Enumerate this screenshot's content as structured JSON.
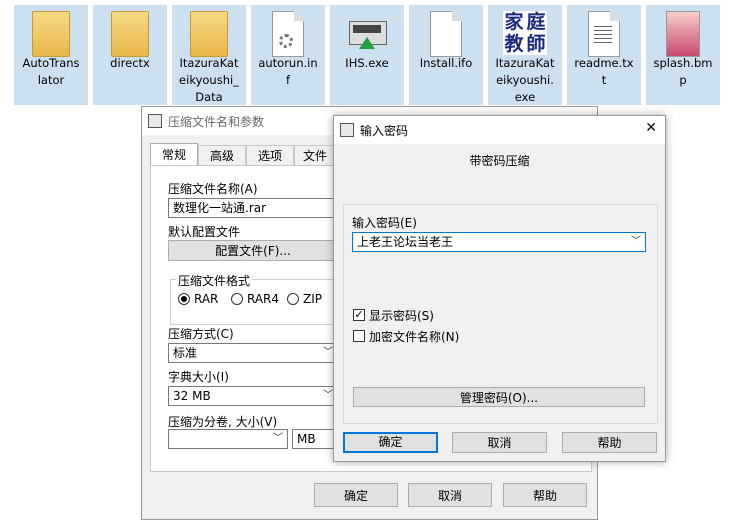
{
  "desktop": {
    "files": [
      {
        "name": "AutoTrans\nlator",
        "type": "folder"
      },
      {
        "name": "directx",
        "type": "folder"
      },
      {
        "name": "ItazuraKat\neikyoushi_\nData",
        "type": "folder"
      },
      {
        "name": "autorun.in\nf",
        "type": "settings-file"
      },
      {
        "name": "IHS.exe",
        "type": "installer"
      },
      {
        "name": "Install.ifo",
        "type": "document"
      },
      {
        "name": "ItazuraKat\neikyoushi.\nexe",
        "type": "app"
      },
      {
        "name": "readme.tx\nt",
        "type": "text"
      },
      {
        "name": "splash.bm\np",
        "type": "image"
      }
    ],
    "app_icon_text": [
      "家",
      "庭",
      "教",
      "師"
    ]
  },
  "archive_dialog": {
    "title": "压缩文件名和参数",
    "tabs": [
      "常规",
      "高级",
      "选项",
      "文件"
    ],
    "archive_name_label": "压缩文件名称(A)",
    "archive_name_value": "数理化一站通.rar",
    "default_profile_label": "默认配置文件",
    "profiles_button": "配置文件(F)...",
    "format_group_label": "压缩文件格式",
    "formats": [
      "RAR",
      "RAR4",
      "ZIP"
    ],
    "method_label": "压缩方式(C)",
    "method_value": "标准",
    "dict_label": "字典大小(I)",
    "dict_value": "32 MB",
    "split_label": "压缩为分卷, 大小(V)",
    "split_unit": "MB",
    "ok": "确定",
    "cancel": "取消",
    "help": "帮助"
  },
  "password_dialog": {
    "title": "输入密码",
    "heading": "带密码压缩",
    "enter_label": "输入密码(E)",
    "password_value": "上老王论坛当老王",
    "show_password_label": "显示密码(S)",
    "encrypt_names_label": "加密文件名称(N)",
    "manage_button": "管理密码(O)...",
    "ok": "确定",
    "cancel": "取消",
    "help": "帮助",
    "close_glyph": "✕",
    "check_glyph": "✓"
  }
}
